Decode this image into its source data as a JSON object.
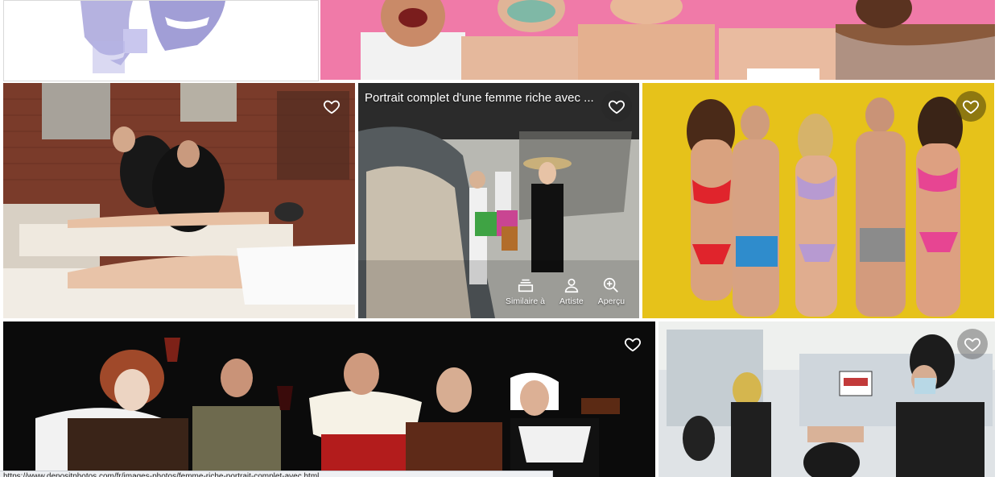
{
  "gallery": {
    "tiles": [
      {
        "id": "tile-1",
        "title": ""
      },
      {
        "id": "tile-2",
        "title": ""
      },
      {
        "id": "tile-3",
        "title": ""
      },
      {
        "id": "tile-4",
        "title": "Portrait complet d'une femme riche avec ..."
      },
      {
        "id": "tile-5",
        "title": ""
      },
      {
        "id": "tile-6",
        "title": ""
      },
      {
        "id": "tile-7",
        "title": ""
      }
    ],
    "hover_actions": {
      "similar_label": "Similaire à",
      "artist_label": "Artiste",
      "preview_label": "Aperçu"
    }
  },
  "status_bar": {
    "url": "https://www.depositphotos.com/fr/images-photos/femme-riche-portrait-complet-avec.html"
  },
  "icons": {
    "favorite": "heart-outline-icon",
    "similar": "stack-icon",
    "artist": "person-icon",
    "preview": "zoom-in-icon"
  },
  "colors": {
    "heart_stroke": "#ffffff",
    "pink_backdrop": "#f07aa8",
    "yellow_backdrop": "#e6c21a",
    "black_backdrop": "#0b0b0b"
  }
}
